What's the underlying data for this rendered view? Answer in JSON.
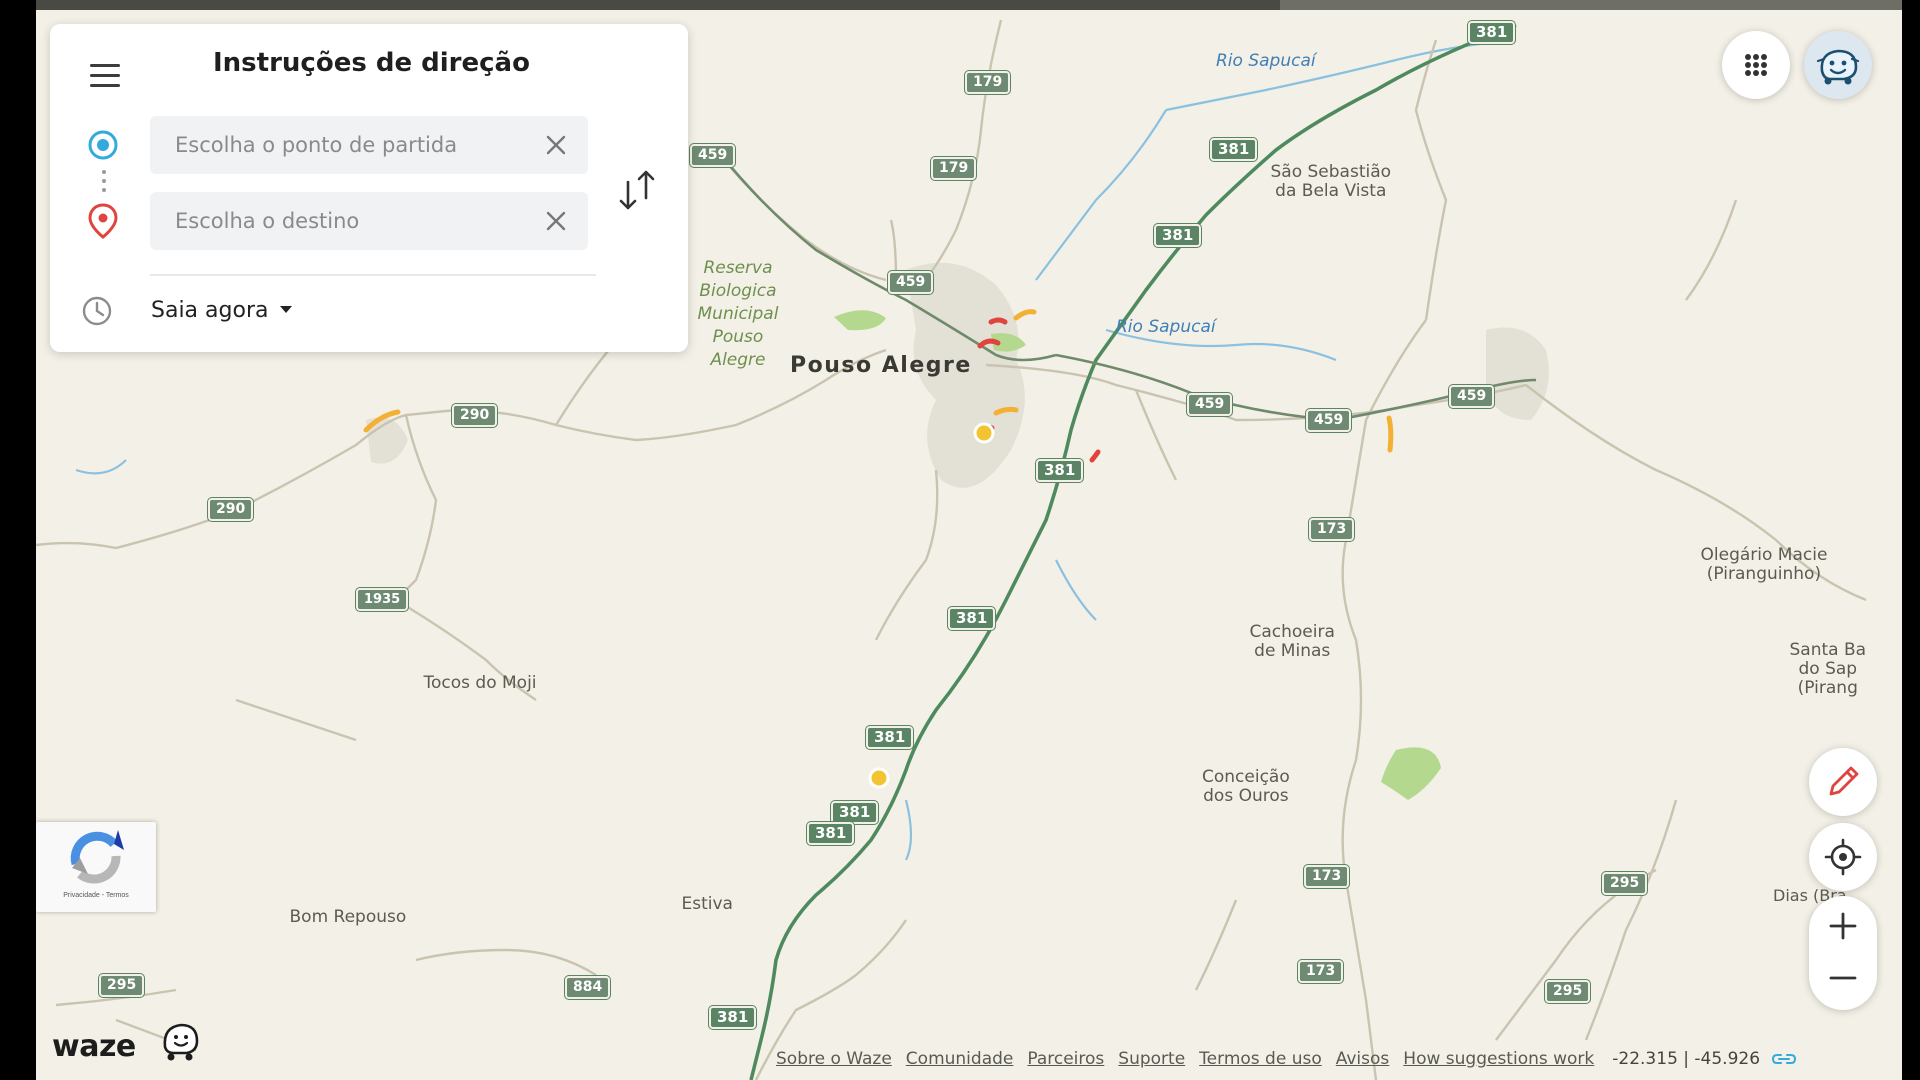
{
  "panel": {
    "title": "Instruções de direção",
    "origin_placeholder": "Escolha o ponto de partida",
    "destination_placeholder": "Escolha o destino",
    "departure_label": "Saia agora"
  },
  "map": {
    "cities": {
      "pouso_alegre": "Pouso Alegre",
      "sao_sebastiao": "São Sebastião\nda Bela Vista",
      "tocos_do_moji": "Tocos do Moji",
      "cachoeira_de_minas": "Cachoeira\nde Minas",
      "conceicao_dos_ouros": "Conceição\ndos Ouros",
      "estiva": "Estiva",
      "bom_repouso": "Bom Repouso",
      "olegario_maciel": "Olegário Macie\n(Piranguinho)",
      "santa_bar": "Santa Ba\ndo Sap\n(Pirang",
      "dias_bra": "Dias (Bra"
    },
    "water": {
      "rio_sapucai_north": "Rio Sapucaí",
      "rio_sapucai_east": "Rio Sapucaí"
    },
    "park": "Reserva\nBiologica\nMunicipal\nPouso\nAlegre",
    "road_numbers": {
      "r381": "381",
      "r459": "459",
      "r179": "179",
      "r290": "290",
      "r1935": "1935",
      "r173": "173",
      "r295": "295",
      "r884": "884"
    }
  },
  "controls": {
    "apps_icon": "grid-icon",
    "avatar_icon": "waze-mood-icon",
    "edit_icon": "pencil-icon",
    "locate_icon": "crosshair-icon",
    "zoom_in": "+",
    "zoom_out": "−"
  },
  "recaptcha": {
    "text": "Privacidade - Termos"
  },
  "brand": {
    "logo": "waze"
  },
  "footer": {
    "links": [
      "Sobre o Waze",
      "Comunidade",
      "Parceiros",
      "Suporte",
      "Termos de uso",
      "Avisos",
      "How suggestions work"
    ],
    "coordinates": "-22.315 | -45.926"
  },
  "colors": {
    "map_background": "#f3f1e7",
    "highway": "#5a8463",
    "minor_road": "#c9c3b0",
    "river": "#8ac0e0",
    "park": "#b5d88f",
    "origin_blue": "#33aadd",
    "destination_red": "#e0443e",
    "traffic_orange": "#f2b134",
    "traffic_red": "#e0443e"
  }
}
